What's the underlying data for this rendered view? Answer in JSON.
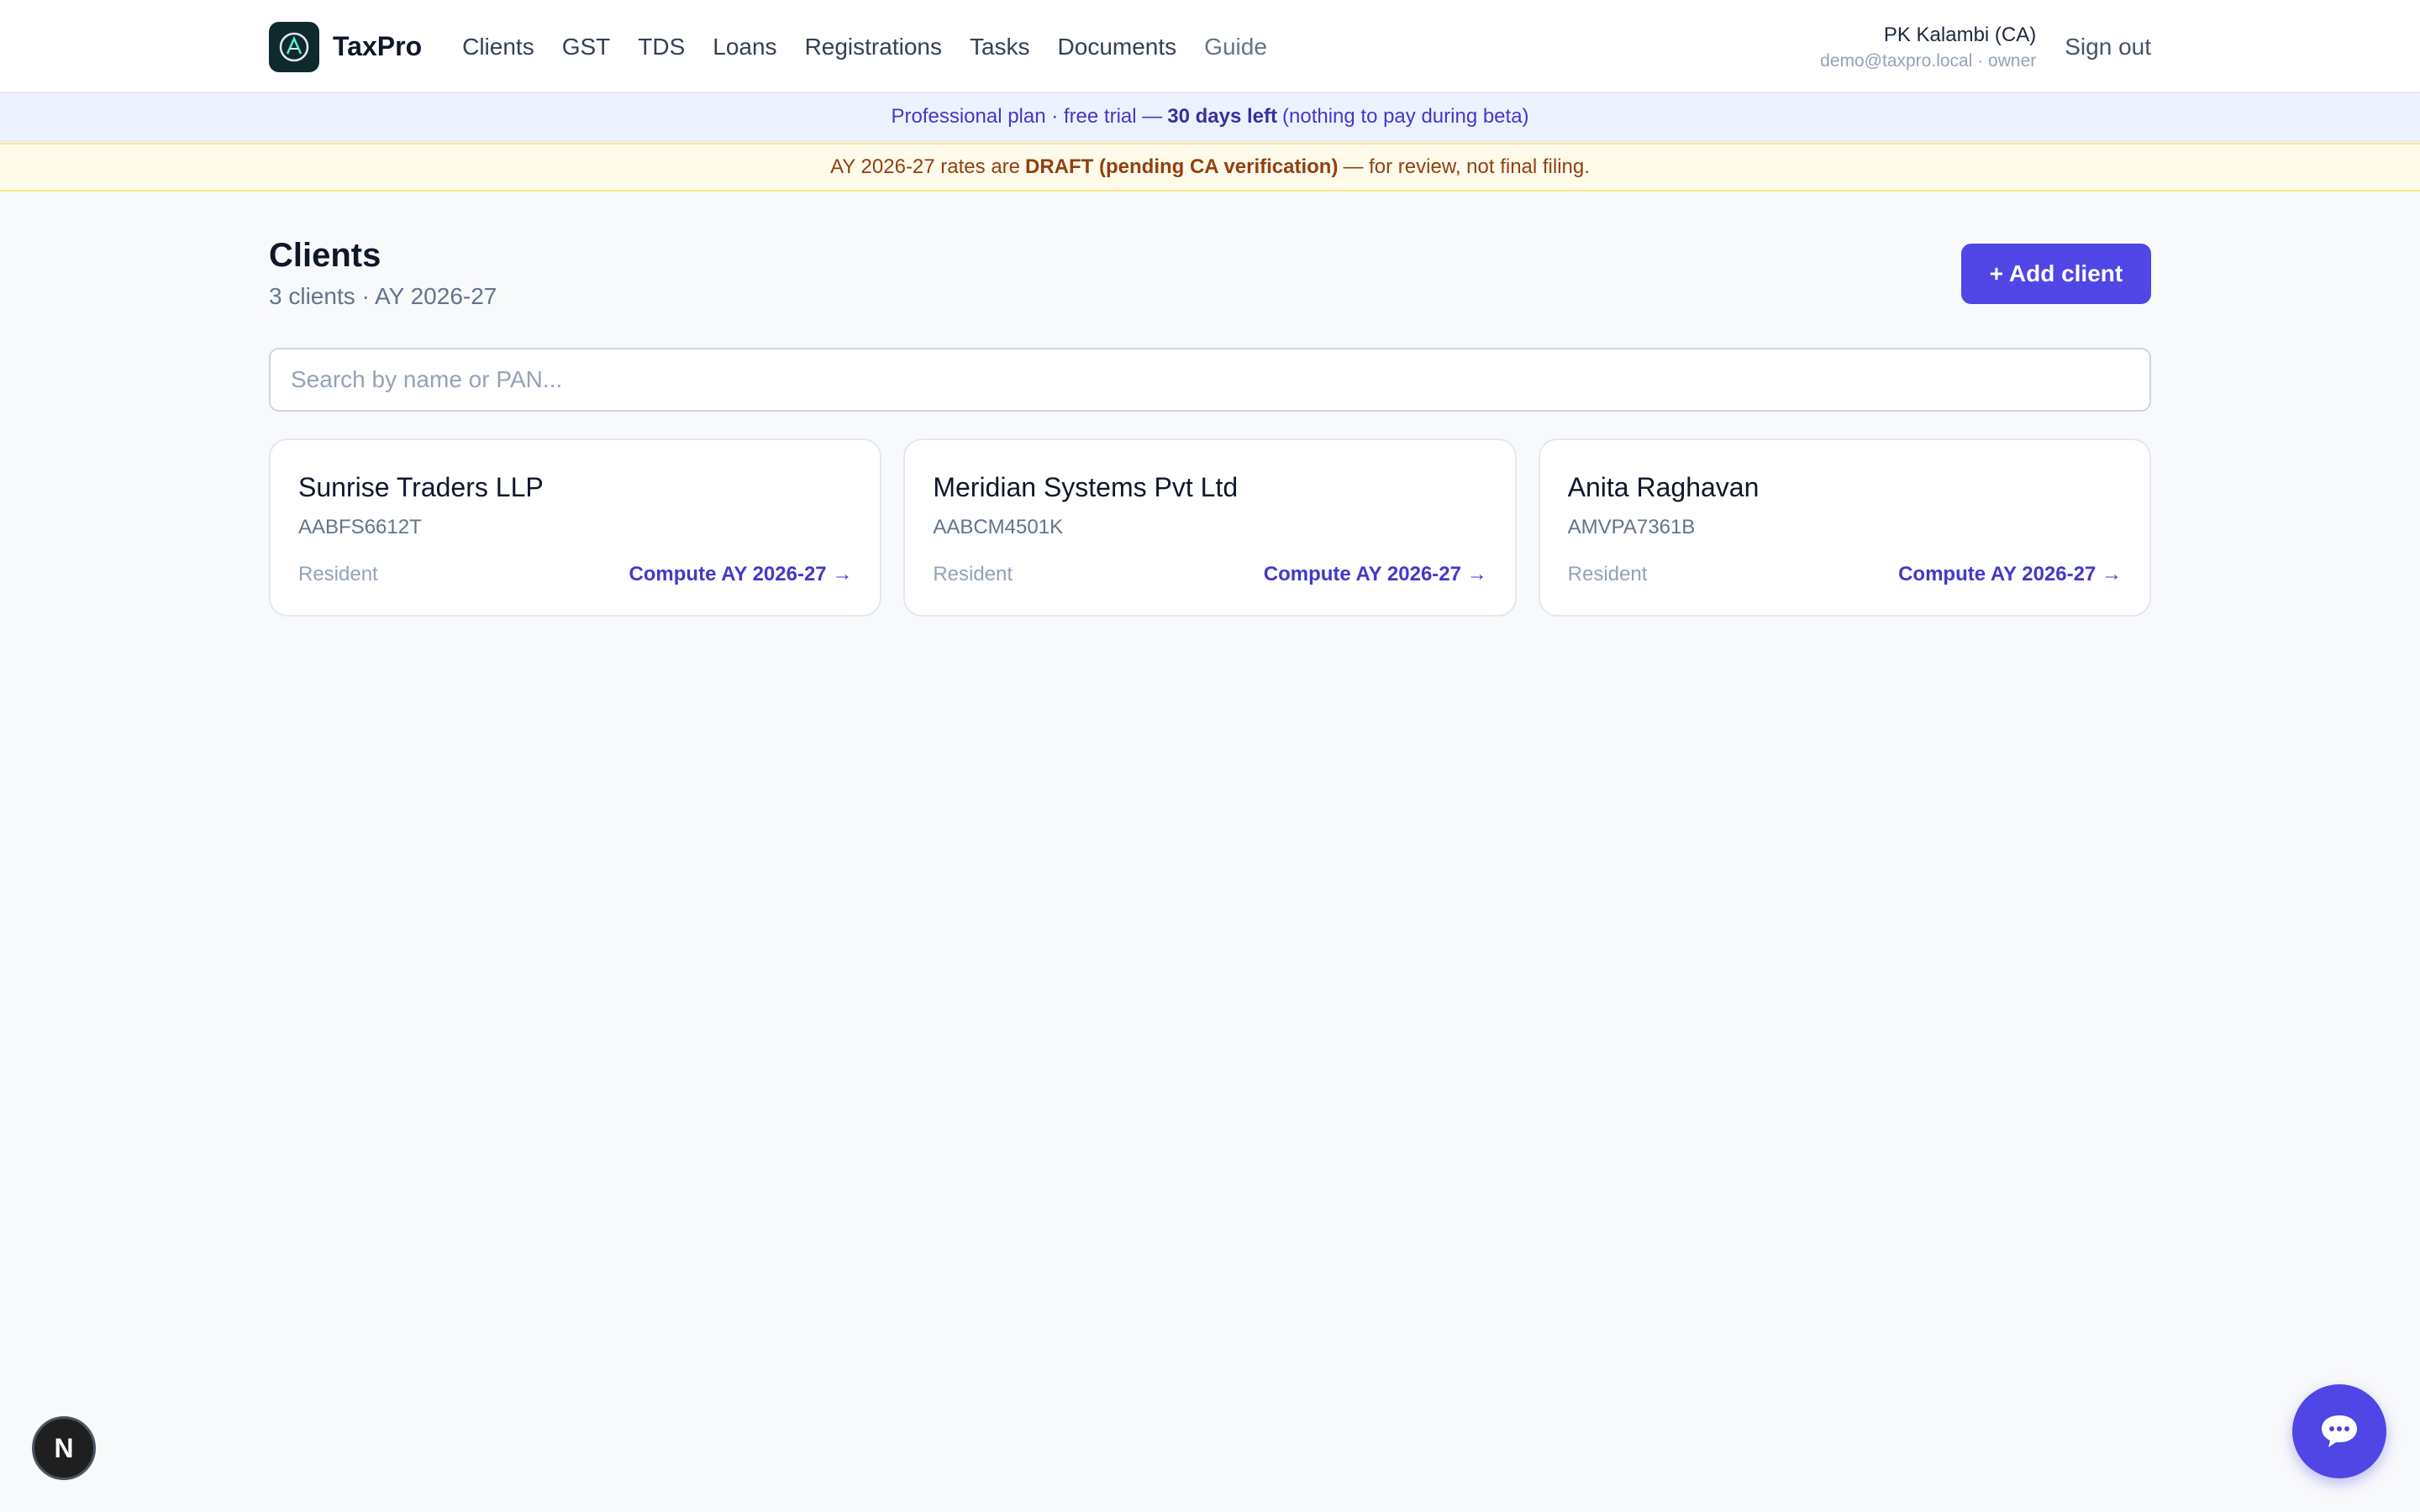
{
  "brand": {
    "name": "TaxPro",
    "logo": "taxpro-logo-icon"
  },
  "nav": [
    {
      "label": "Clients"
    },
    {
      "label": "GST"
    },
    {
      "label": "TDS"
    },
    {
      "label": "Loans"
    },
    {
      "label": "Registrations"
    },
    {
      "label": "Tasks"
    },
    {
      "label": "Documents"
    },
    {
      "label": "Guide"
    }
  ],
  "user": {
    "name": "PK Kalambi (CA)",
    "sub": "demo@taxpro.local · owner",
    "signout": "Sign out"
  },
  "banner_plan": {
    "pre": "Professional plan · free trial —",
    "bold": "30 days left",
    "post": "(nothing to pay during beta)"
  },
  "banner_draft": {
    "pre": "AY 2026-27 rates are",
    "bold": "DRAFT (pending CA verification)",
    "post": "— for review, not final filing."
  },
  "page": {
    "title": "Clients",
    "subtitle": "3 clients · AY 2026-27",
    "add_button": "+ Add client",
    "search_placeholder": "Search by name or PAN..."
  },
  "clients": [
    {
      "name": "Sunrise Traders LLP",
      "pan": "AABFS6612T",
      "status": "Resident",
      "link": "Compute AY 2026-27 →"
    },
    {
      "name": "Meridian Systems Pvt Ltd",
      "pan": "AABCM4501K",
      "status": "Resident",
      "link": "Compute AY 2026-27 →"
    },
    {
      "name": "Anita Raghavan",
      "pan": "AMVPA7361B",
      "status": "Resident",
      "link": "Compute AY 2026-27 →"
    }
  ],
  "floating": {
    "dev_badge": "N",
    "chat_icon": "chat-bubble-icon"
  },
  "colors": {
    "accent": "#4f46e5",
    "plan_banner_bg": "#eef2ff",
    "draft_banner_bg": "#fffbeb",
    "draft_text": "#92400e"
  }
}
